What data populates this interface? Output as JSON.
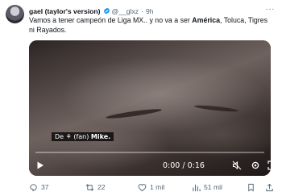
{
  "author": {
    "display_name": "gael (taylor's version)",
    "handle": "@__glxz",
    "separator": "·",
    "time": "9h"
  },
  "more_label": "···",
  "tweet": {
    "text_part1": "Vamos a tener campeón de Liga MX.. y no va a ser ",
    "text_bold": "América",
    "text_part2": ", Toluca, Tigres ni Rayados."
  },
  "video": {
    "caption_prefix": "De ",
    "caption_middle": "(fan) ",
    "caption_bold": "Mike.",
    "timecode": "0:00 / 0:16",
    "progress_fraction": 0.0
  },
  "actions": {
    "replies": "37",
    "reposts": "22",
    "likes": "1 mil",
    "views": "51 mil"
  },
  "colors": {
    "verified": "#1d9bf0",
    "muted_text": "#536471"
  }
}
